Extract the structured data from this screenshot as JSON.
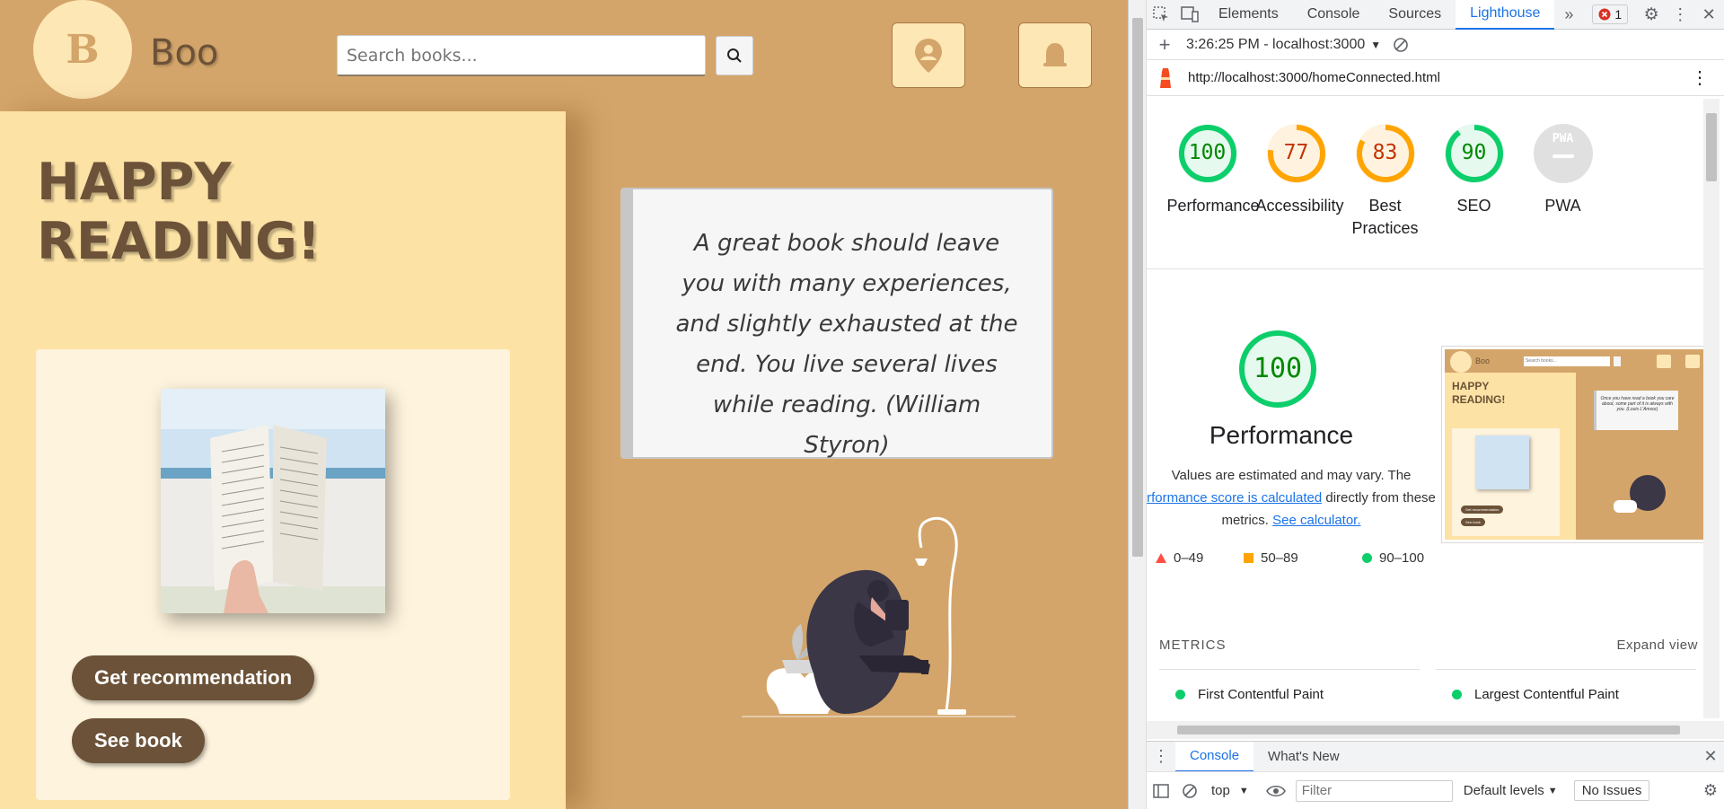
{
  "colors": {
    "accent": "#1a73e8",
    "brand": "#6b5238",
    "app_bg": "#d4a56a",
    "panel_bg": "#fde2a5",
    "score_green": "#0cce6b",
    "score_orange": "#ffa400"
  },
  "app": {
    "brand": "Boo",
    "logo_glyph": "B",
    "search_placeholder": "Search books...",
    "hero_title": "HAPPY READING!",
    "buttons": {
      "recommend": "Get recommendation",
      "see_book": "See book"
    },
    "quote": "A great book should leave you with many experiences, and slightly exhausted at the end. You live several lives while reading. (William Styron)",
    "icons": {
      "search": "search-icon",
      "location": "location-icon",
      "bell": "bell-icon"
    }
  },
  "devtools": {
    "tabs": [
      "Elements",
      "Console",
      "Sources",
      "Lighthouse"
    ],
    "active_tab": "Lighthouse",
    "error_count": "1",
    "report_time": "3:26:25 PM - localhost:3000",
    "url": "http://localhost:3000/homeConnected.html",
    "scores": [
      {
        "label": "Performance",
        "value": "100",
        "fraction": 1.0,
        "color": "green"
      },
      {
        "label": "Accessibility",
        "value": "77",
        "fraction": 0.77,
        "color": "orange"
      },
      {
        "label": "Best Practices",
        "value": "83",
        "fraction": 0.83,
        "color": "orange"
      },
      {
        "label": "SEO",
        "value": "90",
        "fraction": 0.9,
        "color": "green"
      },
      {
        "label": "PWA",
        "value": "PWA",
        "color": "gray"
      }
    ],
    "perf": {
      "score": "100",
      "title": "Performance",
      "desc_1": "Values are estimated and may vary. The",
      "link_1": "rformance score is calculated",
      "desc_2": "directly from these",
      "desc_3": "metrics.",
      "link_2": "See calculator."
    },
    "legend": [
      "0–49",
      "50–89",
      "90–100"
    ],
    "metrics_header": "METRICS",
    "expand": "Expand view",
    "metrics": [
      "First Contentful Paint",
      "Largest Contentful Paint"
    ],
    "thumb": {
      "brand": "Boo",
      "search": "Search books...",
      "hero": "HAPPY READING!",
      "btn1": "Get recommendation",
      "btn2": "See book",
      "quote": "Once you have read a book you care about, some part of it is always with you. (Louis L'Amour)"
    },
    "drawer_tabs": [
      "Console",
      "What's New"
    ],
    "context": "top",
    "filter_placeholder": "Filter",
    "levels": "Default levels",
    "issues": "No Issues"
  }
}
